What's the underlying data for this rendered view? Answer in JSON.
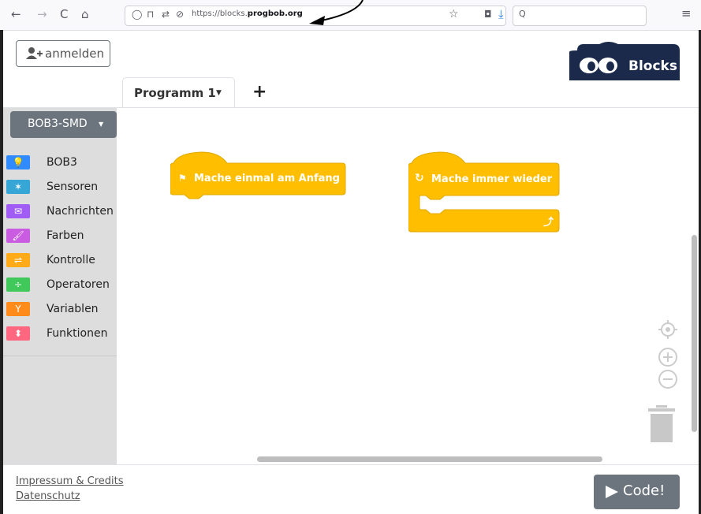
{
  "browser": {
    "url_prefix": "https://blocks.",
    "url_domain": "progbob.org",
    "search_icon": "Q"
  },
  "header": {
    "login_label": "anmelden",
    "logo_text": "Blocks",
    "tab_label": "Programm 1",
    "tab_add": "+"
  },
  "sidebar": {
    "board_label": "BOB3-SMD",
    "categories": [
      {
        "label": "BOB3",
        "color": "#2f8bff",
        "icon": "lightbulb-icon"
      },
      {
        "label": "Sensoren",
        "color": "#35a6d6",
        "icon": "magic-wand-icon"
      },
      {
        "label": "Nachrichten",
        "color": "#a05cf5",
        "icon": "envelope-icon"
      },
      {
        "label": "Farben",
        "color": "#c95ce0",
        "icon": "paintbrush-icon"
      },
      {
        "label": "Kontrolle",
        "color": "#ffab19",
        "icon": "signpost-icon"
      },
      {
        "label": "Operatoren",
        "color": "#40c95a",
        "icon": "divide-icon"
      },
      {
        "label": "Variablen",
        "color": "#ff8c1a",
        "icon": "sprout-icon"
      },
      {
        "label": "Funktionen",
        "color": "#ff6680",
        "icon": "arrows-icon"
      }
    ]
  },
  "workspace": {
    "block_start_label": "Mache einmal am Anfang",
    "block_loop_label": "Mache immer wieder",
    "block_color": "#ffbf00"
  },
  "footer": {
    "impressum_label": "Impressum & Credits",
    "datenschutz_label": "Datenschutz",
    "code_label": "Code!"
  }
}
